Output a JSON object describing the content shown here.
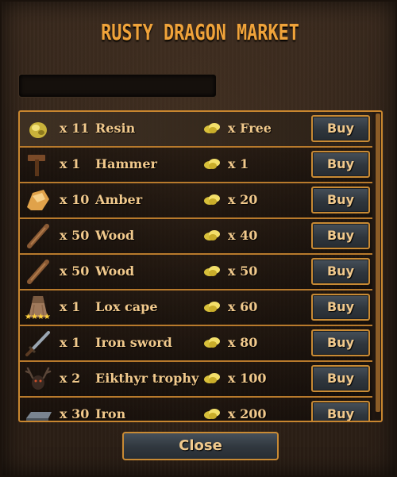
{
  "title": "Rusty Dragon Market",
  "search": {
    "value": ""
  },
  "items": [
    {
      "icon": "resin-icon",
      "qty": "x 11",
      "name": "Resin",
      "price": "x Free",
      "buy_label": "Buy"
    },
    {
      "icon": "hammer-icon",
      "qty": "x 1",
      "name": "Hammer",
      "price": "x 1",
      "buy_label": "Buy"
    },
    {
      "icon": "amber-icon",
      "qty": "x 10",
      "name": "Amber",
      "price": "x 20",
      "buy_label": "Buy"
    },
    {
      "icon": "wood-icon",
      "qty": "x 50",
      "name": "Wood",
      "price": "x 40",
      "buy_label": "Buy"
    },
    {
      "icon": "wood-icon",
      "qty": "x 50",
      "name": "Wood",
      "price": "x 50",
      "buy_label": "Buy"
    },
    {
      "icon": "lox-cape-icon",
      "qty": "x 1",
      "name": "Lox cape",
      "price": "x 60",
      "buy_label": "Buy",
      "stars": "★★★★"
    },
    {
      "icon": "iron-sword-icon",
      "qty": "x 1",
      "name": "Iron sword",
      "price": "x 80",
      "buy_label": "Buy"
    },
    {
      "icon": "eikthyr-trophy-icon",
      "qty": "x 2",
      "name": "Eikthyr trophy",
      "price": "x 100",
      "buy_label": "Buy"
    },
    {
      "icon": "iron-bar-icon",
      "qty": "x 30",
      "name": "Iron",
      "price": "x 200",
      "buy_label": "Buy"
    }
  ],
  "currency_icon": "gold-coins-icon",
  "close_label": "Close",
  "colors": {
    "accent": "#f0a33a",
    "text": "#f1c98c",
    "border": "#c8862f"
  }
}
